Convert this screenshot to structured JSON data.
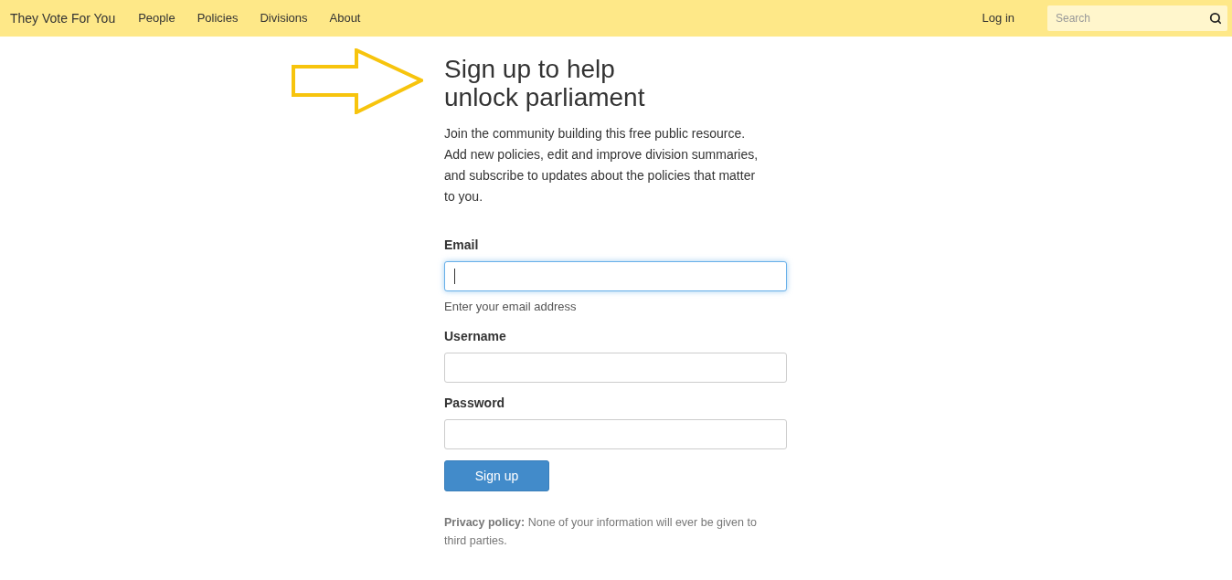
{
  "navbar": {
    "brand": "They Vote For You",
    "links": [
      {
        "label": "People"
      },
      {
        "label": "Policies"
      },
      {
        "label": "Divisions"
      },
      {
        "label": "About"
      }
    ],
    "login": "Log in",
    "search": {
      "placeholder": "Search"
    }
  },
  "signup": {
    "heading": "Sign up to help unlock parliament",
    "intro": "Join the community building this free public resource. Add new policies, edit and improve division summaries, and subscribe to updates about the policies that matter to you.",
    "fields": [
      {
        "label": "Email",
        "focused": true,
        "help": "Enter your email address"
      },
      {
        "label": "Username",
        "focused": false
      },
      {
        "label": "Password",
        "focused": false
      }
    ],
    "button": "Sign up",
    "privacy": "**Privacy policy:** None of your information will ever be given to third parties."
  }
}
